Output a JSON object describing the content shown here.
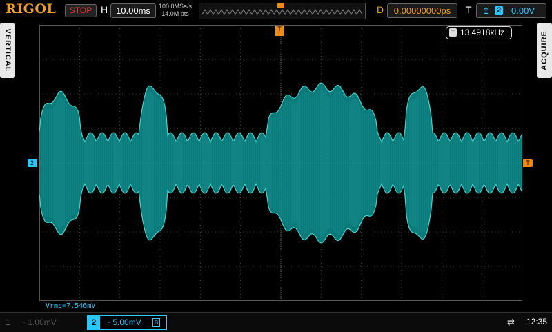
{
  "header": {
    "brand": "RIGOL",
    "run_state": "STOP",
    "h_label": "H",
    "timebase": "10.00ms",
    "sample_rate": "100.0MSa/s",
    "memory_depth": "14.0M pts",
    "d_label": "D",
    "delay": "0.00000000ps",
    "t_label": "T",
    "trigger_edge": "rising-edge-icon",
    "trigger_channel": "2",
    "trigger_level": "0.00V"
  },
  "side": {
    "left_label": "VERTICAL",
    "right_label": "ACQUIRE"
  },
  "screen": {
    "frequency": "13.4918kHz",
    "freq_tag": "T",
    "channel_marker": "2",
    "trigger_marker": "T",
    "top_trigger_marker": "T",
    "measurement": "Vrms=7.546mV"
  },
  "footer": {
    "ch1_number": "1",
    "ch1_scale": "~ 1.00mV",
    "ch2_number": "2",
    "ch2_scale": "~ 5.00mV",
    "ch2_bw_icon": "B",
    "usb_icon": "usb-icon",
    "time": "12:35"
  },
  "colors": {
    "ch2": "#29c8ff",
    "trigger": "#f08a10",
    "brand": "#f0a020",
    "stop": "#e33333"
  }
}
